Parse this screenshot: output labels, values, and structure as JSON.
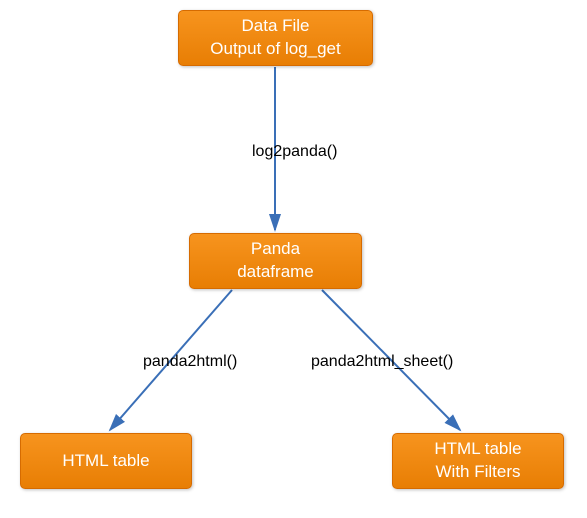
{
  "nodes": {
    "datafile": {
      "line1": "Data File",
      "line2": "Output of log_get"
    },
    "dataframe": {
      "line1": "Panda",
      "line2": "dataframe"
    },
    "htmltable": {
      "line1": "HTML table"
    },
    "htmlfilters": {
      "line1": "HTML table",
      "line2": "With Filters"
    }
  },
  "edges": {
    "log2panda": "log2panda()",
    "panda2html": "panda2html()",
    "panda2html_sheet": "panda2html_sheet()"
  },
  "colors": {
    "node_fill_top": "#f7941e",
    "node_fill_bottom": "#e87e04",
    "node_border": "#d66b00",
    "arrow": "#3a6fb7"
  }
}
